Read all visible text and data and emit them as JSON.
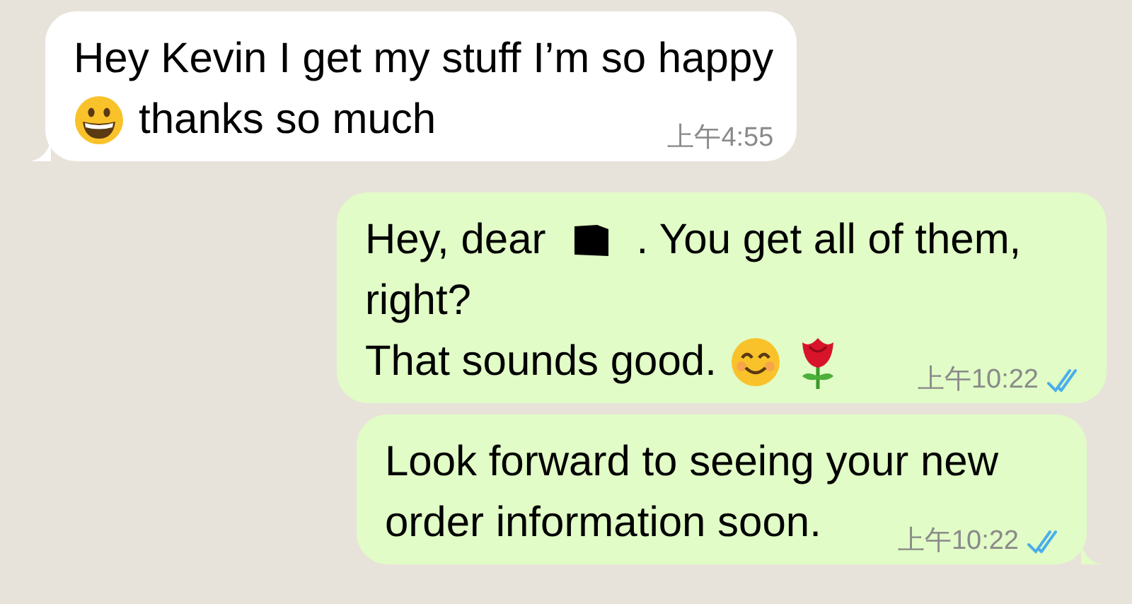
{
  "messages": [
    {
      "kind": "incoming",
      "tail": true,
      "lines": [
        [
          {
            "kind": "text",
            "text": "Hey Kevin I get my stuff I’m so happy"
          }
        ],
        [
          {
            "kind": "grin-emoji"
          },
          {
            "kind": "text",
            "text": "thanks so much"
          }
        ]
      ],
      "time": "上午4:55"
    },
    {
      "kind": "outgoing",
      "tail": false,
      "read": true,
      "lines": [
        [
          {
            "kind": "text",
            "text": "Hey, dear"
          },
          {
            "kind": "redaction"
          },
          {
            "kind": "text",
            "text": ". You get all of them,"
          }
        ],
        [
          {
            "kind": "text",
            "text": "right?"
          }
        ],
        [
          {
            "kind": "text",
            "text": "That sounds good."
          },
          {
            "kind": "smile-emoji"
          },
          {
            "kind": "rose-emoji"
          }
        ]
      ],
      "time": "上午10:22"
    },
    {
      "kind": "outgoing",
      "tail": true,
      "read": true,
      "lines": [
        [
          {
            "kind": "text",
            "text": "Look forward to seeing your new"
          }
        ],
        [
          {
            "kind": "text",
            "text": "order information soon."
          }
        ]
      ],
      "time": "上午10:22"
    }
  ]
}
